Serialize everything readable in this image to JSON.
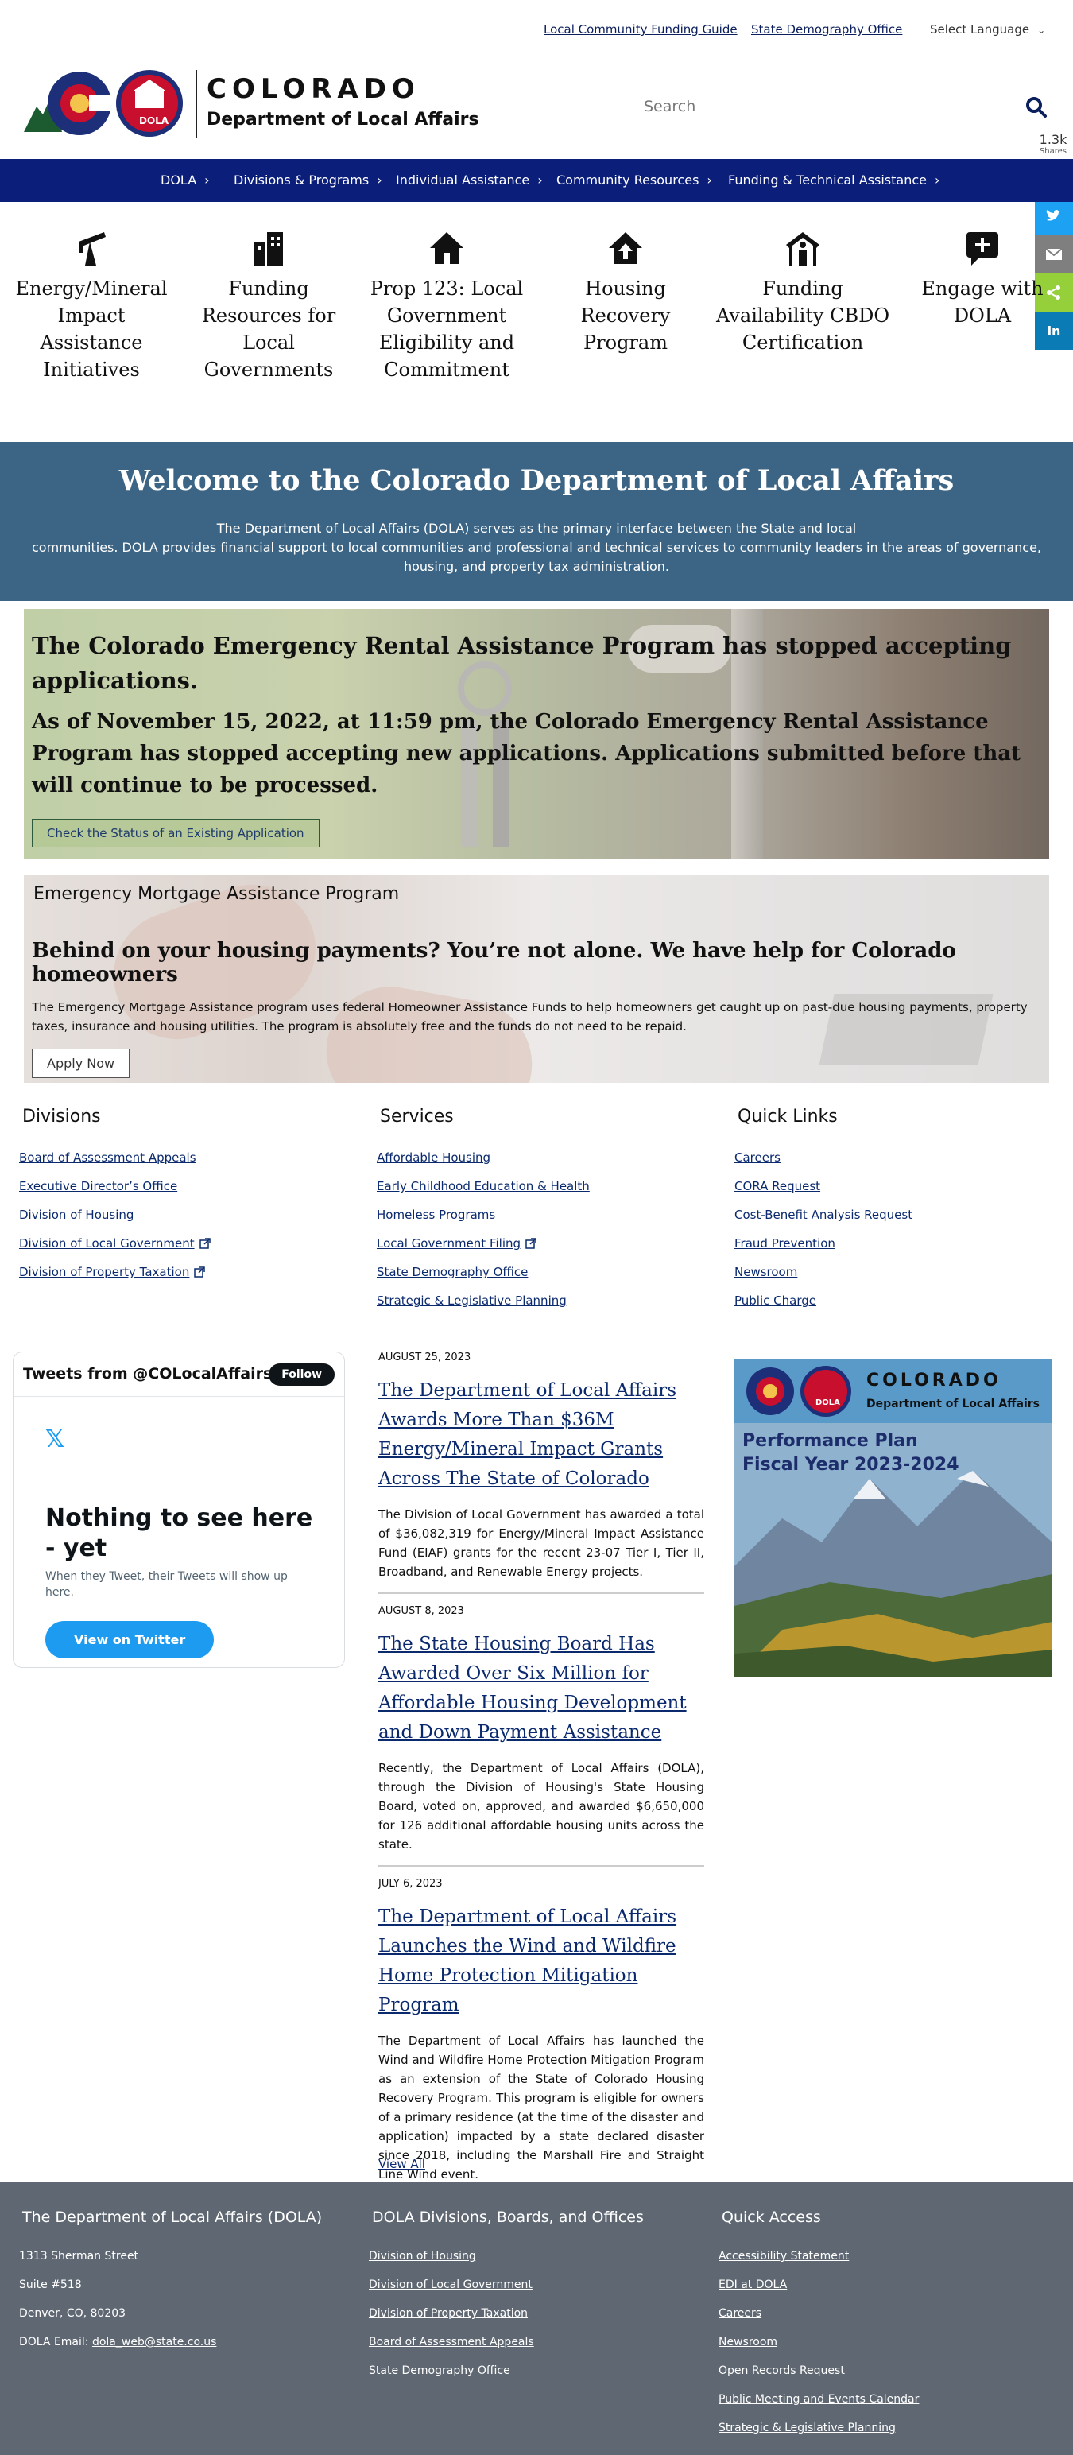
{
  "utility": {
    "funding_guide": "Local Community Funding Guide",
    "demography": "State Demography Office",
    "language": "Select Language"
  },
  "header": {
    "brand_main": "COLORADO",
    "brand_sub": "Department of Local Affairs",
    "logo_badge": "DOLA",
    "search_placeholder": "Search"
  },
  "share": {
    "count": "1.3k",
    "label": "Shares",
    "buttons": [
      "facebook-icon",
      "twitter-icon",
      "email-icon",
      "share-icon",
      "linkedin-icon"
    ],
    "colors": [
      "#3b5998",
      "#1da1f2",
      "#7f7f7f",
      "#95d03a",
      "#0a7bb5"
    ]
  },
  "nav": {
    "items": [
      "DOLA",
      "Divisions & Programs",
      "Individual Assistance",
      "Community Resources",
      "Funding & Technical Assistance"
    ]
  },
  "tiles": [
    {
      "label": "Energy/Mineral Impact Assistance Initiatives",
      "icon": "oil-pump-icon"
    },
    {
      "label": "Funding Resources for Local Governments",
      "icon": "buildings-icon"
    },
    {
      "label": "Prop 123: Local Government Eligibility and Commitment",
      "icon": "house-icon"
    },
    {
      "label": "Housing Recovery Program",
      "icon": "house-recovery-icon"
    },
    {
      "label": "Funding Availability CBDO Certification",
      "icon": "person-house-icon"
    },
    {
      "label": "Engage with DOLA",
      "icon": "chat-plus-icon"
    }
  ],
  "welcome": {
    "title": "Welcome to the Colorado Department of Local Affairs",
    "line1": "The Department of Local Affairs (DOLA) serves as the primary interface between the State and local",
    "line2": "communities. DOLA provides financial support to local communities and professional and technical services to community leaders in the areas of governance, housing, and property tax administration."
  },
  "rental": {
    "heading": "The Colorado Emergency Rental Assistance Program has stopped accepting applications.",
    "sub": "As of November 15, 2022, at 11:59 pm, the Colorado Emergency Rental Assistance Program has stopped accepting new applications. Applications submitted before that will continue to be processed.",
    "button": "Check the Status of an Existing Application"
  },
  "mortgage": {
    "title": "Emergency Mortgage Assistance Program",
    "heading": "Behind on your housing payments? You’re not alone. We have help for Colorado homeowners",
    "body": "The Emergency Mortgage Assistance program uses federal Homeowner Assistance Funds to help homeowners get caught up on past-due housing payments, property taxes, insurance and housing utilities. The program is absolutely free and the funds do not need to be repaid.",
    "button": "Apply Now"
  },
  "divisions": {
    "title": "Divisions",
    "items": [
      "Board of Assessment Appeals",
      "Executive Director’s Office",
      "Division of Housing",
      "Division of Local Government",
      "Division of Property Taxation"
    ]
  },
  "services": {
    "title": "Services",
    "items": [
      "Affordable Housing",
      "Early Childhood Education & Health",
      "Homeless Programs",
      "Local Government Filing",
      "State Demography Office",
      "Strategic & Legislative Planning"
    ]
  },
  "quicklinks": {
    "title": "Quick Links",
    "items": [
      "Careers",
      "CORA Request",
      "Cost-Benefit Analysis Request",
      "Fraud Prevention",
      "Newsroom",
      "Public Charge"
    ]
  },
  "twitter": {
    "title": "Tweets from @COLocalAffairs",
    "follow": "Follow",
    "empty_title": "Nothing to see here - yet",
    "empty_sub": "When they Tweet, their Tweets will show up here.",
    "button": "View on Twitter"
  },
  "news": [
    {
      "date": "AUGUST 25, 2023",
      "title": "The Department of Local Affairs Awards More Than $36M Energy/Mineral Impact Grants Across The State of Colorado",
      "body": "The Division of Local Government has awarded a total of $36,082,319 for Energy/Mineral Impact Assistance Fund (EIAF) grants for the recent 23-07 Tier I, Tier II, Broadband, and Renewable Energy projects."
    },
    {
      "date": "AUGUST 8, 2023",
      "title": "The State Housing Board Has Awarded Over Six Million for Affordable Housing Development and Down Payment Assistance",
      "body": "Recently, the Department of Local Affairs (DOLA), through the Division of Housing's State Housing Board, voted on, approved, and awarded $6,650,000 for 126 additional affordable housing units across the state."
    },
    {
      "date": "JULY 6, 2023",
      "title": "The Department of Local Affairs Launches the Wind and Wildfire Home Protection Mitigation Program",
      "body": "The Department of Local Affairs has launched the Wind and Wildfire Home Protection Mitigation Program as an extension of the State of Colorado Housing Recovery Program. This program is eligible for owners of a primary residence (at the time of the disaster and application) impacted by a state declared disaster since 2018, including the Marshall Fire and Straight Line Wind event."
    }
  ],
  "view_all": "View All",
  "plan": {
    "brand_main": "COLORADO",
    "brand_sub": "Department of Local Affairs",
    "badge": "DOLA",
    "line1": "Performance Plan",
    "line2": "Fiscal Year 2023-2024"
  },
  "footer": {
    "dola": {
      "title": "The Department of Local Affairs (DOLA)",
      "address1": "1313 Sherman Street",
      "address2": "Suite  #518",
      "address3": "Denver, CO, 80203",
      "email_label": "DOLA Email:",
      "email": "dola_web@state.co.us"
    },
    "divisions": {
      "title": "DOLA Divisions, Boards, and Offices",
      "items": [
        "Division of Housing",
        "Division of Local Government",
        "Division of Property Taxation",
        "Board of Assessment Appeals",
        "State Demography Office"
      ]
    },
    "quick": {
      "title": "Quick Access",
      "items": [
        "Accessibility Statement",
        "EDI at DOLA",
        "Careers",
        "Newsroom",
        "Open Records Request",
        "Public Meeting and Events Calendar",
        "Strategic & Legislative Planning"
      ]
    }
  },
  "colors": {
    "nav": "#0a1e7a",
    "welcome": "#3c6585",
    "footer": "#5f6872",
    "link": "#0b2a6e"
  }
}
